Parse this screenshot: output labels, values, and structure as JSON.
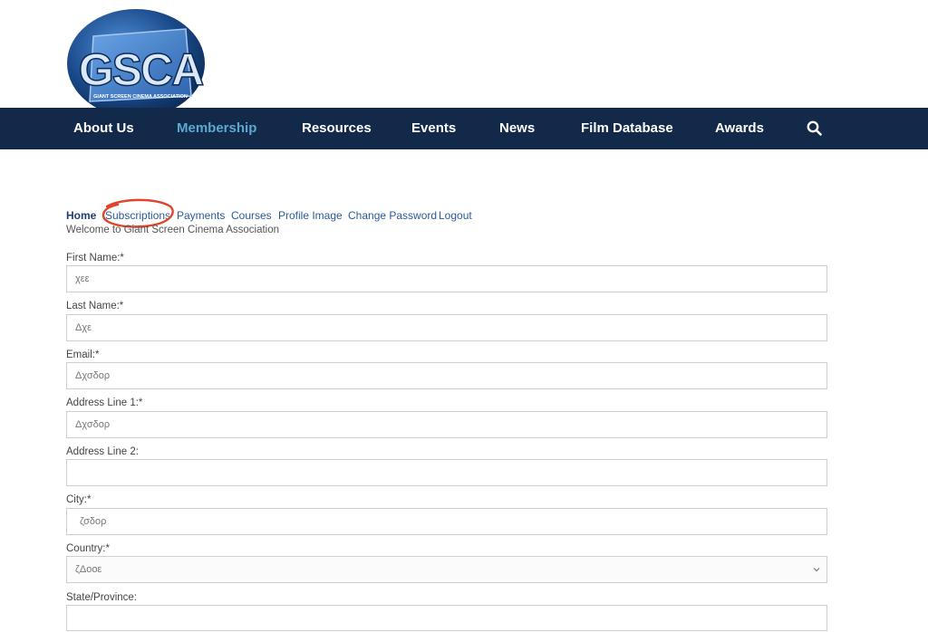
{
  "logo": {
    "main_text": "GSCA",
    "sub_text": "GIANT SCREEN CINEMA ASSOCIATION",
    "colors": {
      "circle": "#1a4a8a",
      "panel": "#3a78c4",
      "letters": "#dbe8f7"
    }
  },
  "nav": {
    "items": [
      {
        "label": "About Us",
        "active": false
      },
      {
        "label": "Membership",
        "active": true
      },
      {
        "label": "Resources",
        "active": false
      },
      {
        "label": "Events",
        "active": false
      },
      {
        "label": "News",
        "active": false
      },
      {
        "label": "Film Database",
        "active": false
      },
      {
        "label": "Awards",
        "active": false
      }
    ],
    "search_icon": "search-icon",
    "colors": {
      "background": "#12294a",
      "text": "#ffffff",
      "active": "#5ba9cf"
    }
  },
  "tabs": [
    {
      "label": "Home"
    },
    {
      "label": "Subscriptions"
    },
    {
      "label": "Payments"
    },
    {
      "label": "Courses"
    },
    {
      "label": "Profile Image"
    },
    {
      "label": "Change Password"
    },
    {
      "label": "Logout"
    }
  ],
  "welcome_text": "Welcome to Giant Screen Cinema Association",
  "form": {
    "fields": [
      {
        "label": "First Name:*",
        "value": "χεε"
      },
      {
        "label": "Last Name:*",
        "value": "Δχε"
      },
      {
        "label": "Email:*",
        "value": "Δχσδορ"
      },
      {
        "label": "Address Line 1:*",
        "value": "Δχσδορ"
      },
      {
        "label": "Address Line 2:",
        "value": ""
      },
      {
        "label": "City:*",
        "value": "ζσδορ"
      },
      {
        "label": "Country:*",
        "value": "ζΔοοε"
      },
      {
        "label": "State/Province:",
        "value": ""
      }
    ]
  },
  "annotation_color": "#e0442a"
}
